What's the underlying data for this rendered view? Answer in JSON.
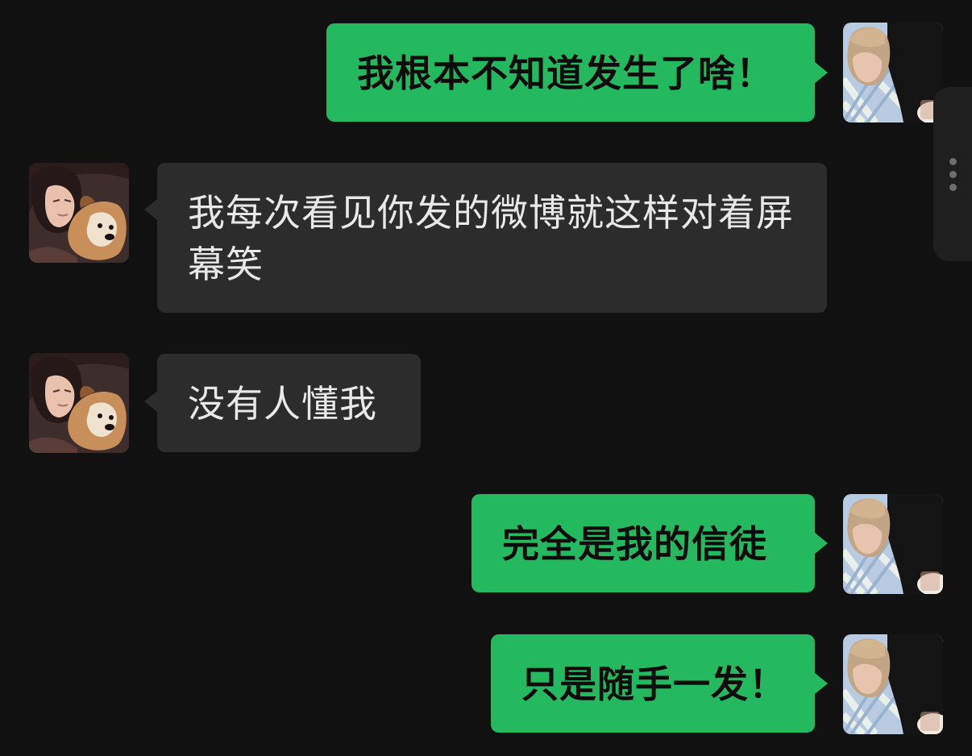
{
  "conversation": {
    "messages": [
      {
        "sender": "me",
        "text": "我根本不知道发生了啥！"
      },
      {
        "sender": "contact",
        "text": "我每次看见你发的微博就这样对着屏幕笑"
      },
      {
        "sender": "contact",
        "text": "没有人懂我"
      },
      {
        "sender": "me",
        "text": "完全是我的信徒"
      },
      {
        "sender": "me",
        "text": "只是随手一发！"
      }
    ]
  },
  "colors": {
    "background": "#111111",
    "outgoing_bubble": "#25b95f",
    "incoming_bubble": "#2c2c2c",
    "incoming_text": "#e8e8e8",
    "outgoing_text": "#0c0c0c"
  },
  "icons": {
    "side_handle": "more-vertical-icon"
  }
}
